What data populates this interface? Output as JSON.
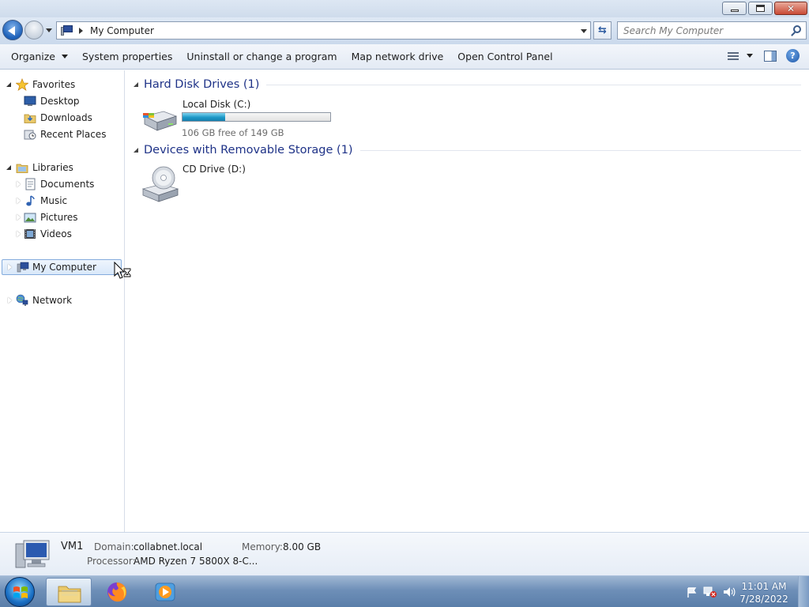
{
  "window": {
    "title_buttons": [
      "minimize",
      "maximize",
      "close"
    ]
  },
  "address": {
    "location": "My Computer"
  },
  "search": {
    "placeholder": "Search My Computer"
  },
  "toolbar": {
    "organize": "Organize",
    "system_properties": "System properties",
    "uninstall": "Uninstall or change a program",
    "map_drive": "Map network drive",
    "control_panel": "Open Control Panel"
  },
  "nav": {
    "favorites": "Favorites",
    "desktop": "Desktop",
    "downloads": "Downloads",
    "recent_places": "Recent Places",
    "libraries": "Libraries",
    "documents": "Documents",
    "music": "Music",
    "pictures": "Pictures",
    "videos": "Videos",
    "my_computer": "My Computer",
    "network": "Network"
  },
  "content": {
    "hard_disk_header": "Hard Disk Drives (1)",
    "removable_header": "Devices with Removable Storage (1)",
    "local_disk": {
      "name": "Local Disk (C:)",
      "free_text": "106 GB free of 149 GB",
      "used_fraction": 0.29
    },
    "cd_drive": {
      "name": "CD Drive (D:)"
    }
  },
  "details": {
    "computer_name": "VM1",
    "domain_label": "Domain:",
    "domain_value": "collabnet.local",
    "memory_label": "Memory:",
    "memory_value": "8.00 GB",
    "processor_label": "Processor:",
    "processor_value": "AMD Ryzen 7 5800X 8-C..."
  },
  "taskbar": {
    "clock_time": "11:01 AM",
    "clock_date": "7/28/2022"
  },
  "colors": {
    "group_header": "#1e3287",
    "drive_fill": "#1c98c7",
    "taskbar": "#6e8fb8"
  }
}
